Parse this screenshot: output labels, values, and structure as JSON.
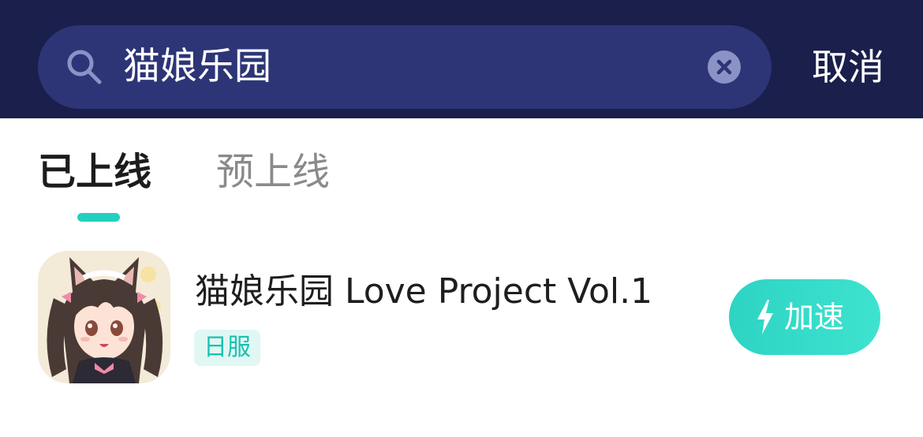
{
  "search": {
    "query": "猫娘乐园",
    "cancel_label": "取消"
  },
  "tabs": [
    {
      "label": "已上线",
      "active": true
    },
    {
      "label": "预上线",
      "active": false
    }
  ],
  "results": [
    {
      "title": "猫娘乐园 Love Project Vol.1",
      "region": "日服",
      "action_label": "加速"
    }
  ],
  "colors": {
    "topbar": "#1a1f4b",
    "searchbox": "#2d3577",
    "accent": "#21d0bf"
  },
  "icons": {
    "search": "search-icon",
    "clear": "clear-icon",
    "bolt": "bolt-icon"
  }
}
